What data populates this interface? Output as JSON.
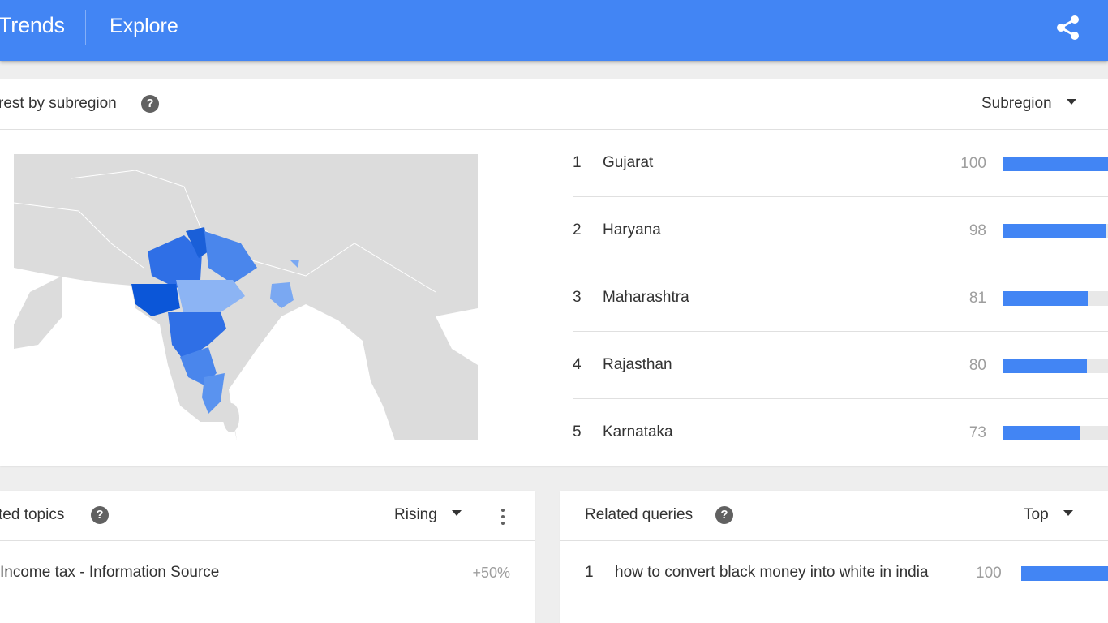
{
  "header": {
    "brand": "Trends",
    "nav_explore": "Explore",
    "share_icon": "share-icon",
    "color": "#4285f4"
  },
  "subregion": {
    "title": "rest by subregion",
    "dropdown_label": "Subregion",
    "rankings": [
      {
        "rank": "1",
        "name": "Gujarat",
        "value": "100",
        "score": 100
      },
      {
        "rank": "2",
        "name": "Haryana",
        "value": "98",
        "score": 98
      },
      {
        "rank": "3",
        "name": "Maharashtra",
        "value": "81",
        "score": 81
      },
      {
        "rank": "4",
        "name": "Rajasthan",
        "value": "80",
        "score": 80
      },
      {
        "rank": "5",
        "name": "Karnataka",
        "value": "73",
        "score": 73
      }
    ],
    "bar_color": "#4285f4"
  },
  "topics": {
    "title": "ted topics",
    "dropdown_label": "Rising",
    "items": [
      {
        "name": "Income tax - Information Source",
        "value": "+50%"
      }
    ]
  },
  "queries": {
    "title": "Related queries",
    "dropdown_label": "Top",
    "items": [
      {
        "rank": "1",
        "text": "how to convert black money into white in india",
        "value": "100",
        "score": 100
      }
    ]
  }
}
